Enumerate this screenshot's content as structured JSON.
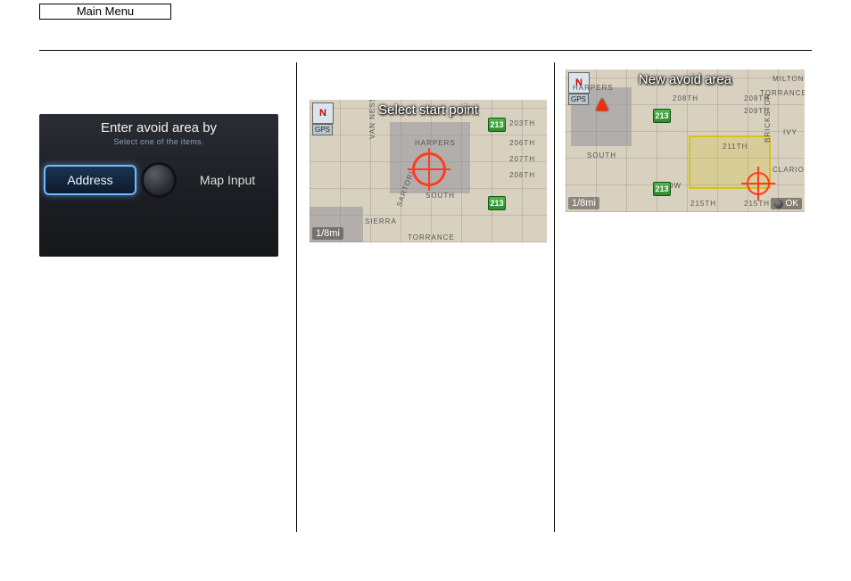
{
  "top_button": "Main Menu",
  "screen1": {
    "title": "Enter avoid area by",
    "subtitle": "Select one of the items.",
    "option_address": "Address",
    "option_map": "Map Input"
  },
  "screen2": {
    "banner": "Select start point",
    "scale": "1/8mi",
    "compass": "N",
    "gps": "GPS",
    "streets": {
      "harpers": "HARPERS",
      "south": "SOUTH",
      "sierra": "SIERRA",
      "torrance": "TORRANCE",
      "van_ness": "VAN NESS",
      "sartori": "SARTORI",
      "s203": "203TH",
      "s206": "206TH",
      "s207": "207TH",
      "s208": "208TH"
    },
    "shields": {
      "a": "213",
      "b": "213"
    }
  },
  "screen3": {
    "banner": "New avoid area",
    "scale": "1/8mi",
    "compass": "N",
    "gps": "GPS",
    "ok": "OK",
    "streets": {
      "harpers": "HARPERS",
      "south": "SOUTH",
      "milton": "MILTON",
      "torrance": "TORRANCE",
      "ivy": "IVY",
      "clarion": "CLARION",
      "bow": "BOW",
      "s208a": "208TH",
      "s208b": "208TH",
      "s209": "209TH",
      "s211": "211TH",
      "s215a": "215TH",
      "s215b": "215TH",
      "brickston": "BRICKSTON"
    },
    "shields": {
      "a": "213",
      "b": "213"
    }
  }
}
